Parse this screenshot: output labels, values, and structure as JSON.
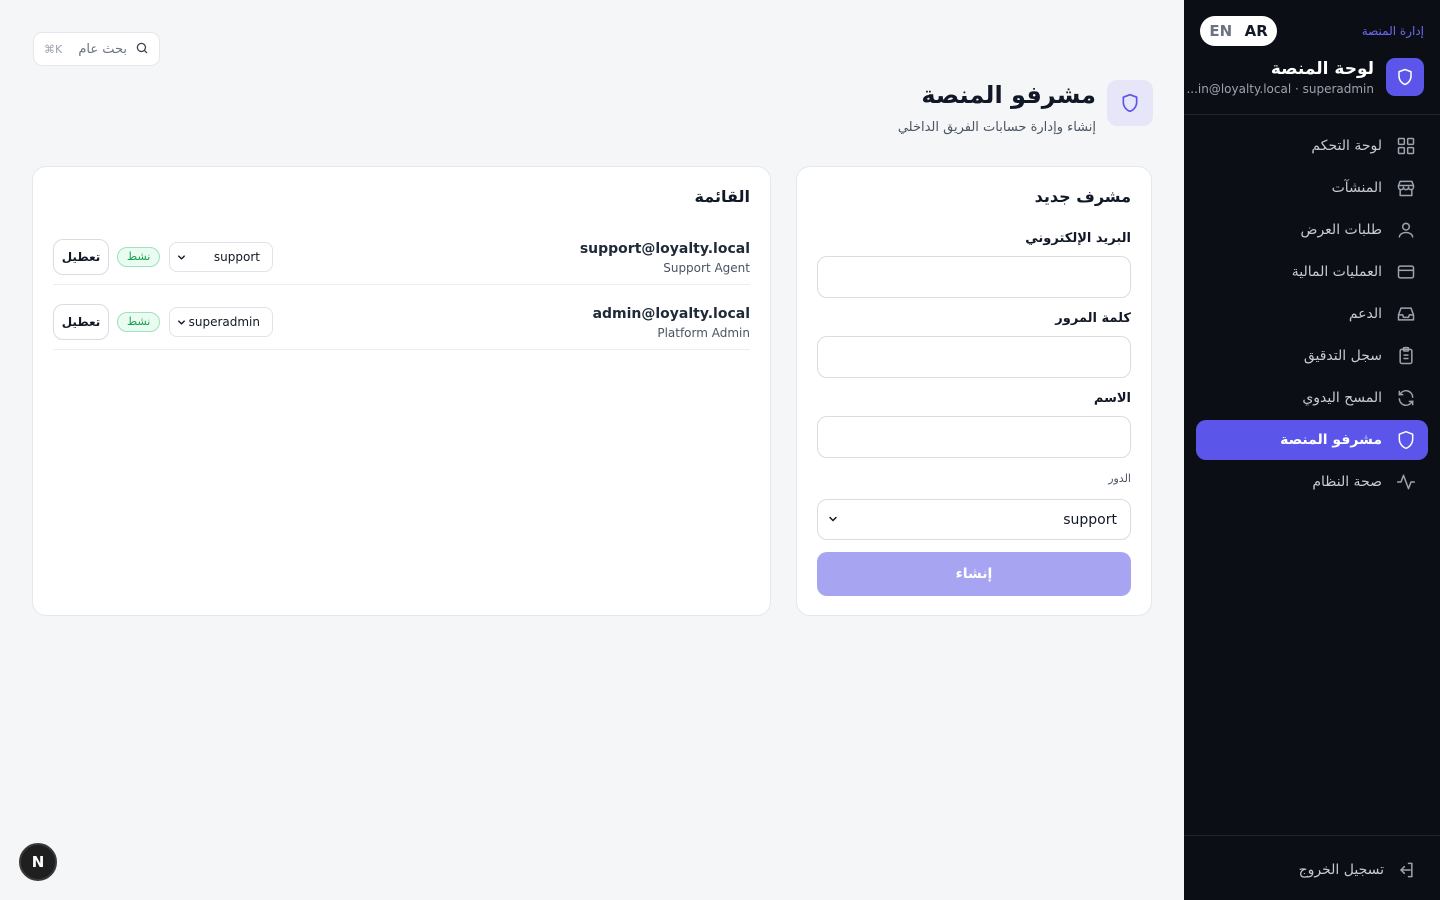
{
  "sidebar": {
    "section_label": "إدارة المنصة",
    "lang": {
      "en": "EN",
      "ar": "AR",
      "active": "AR"
    },
    "brand": {
      "title": "لوحة المنصة",
      "subtitle": "superadmin · admin@loyalty.local",
      "subtitle_display": "...in@loyalty.local · superadmin"
    },
    "nav": [
      {
        "label": "لوحة التحكم",
        "icon": "grid-icon"
      },
      {
        "label": "المنشآت",
        "icon": "store-icon"
      },
      {
        "label": "طلبات العرض",
        "icon": "user-icon"
      },
      {
        "label": "العمليات المالية",
        "icon": "card-icon"
      },
      {
        "label": "الدعم",
        "icon": "inbox-icon"
      },
      {
        "label": "سجل التدقيق",
        "icon": "clipboard-icon"
      },
      {
        "label": "المسح اليدوي",
        "icon": "refresh-icon"
      },
      {
        "label": "مشرفو المنصة",
        "icon": "shield-icon",
        "active": true
      },
      {
        "label": "صحة النظام",
        "icon": "activity-icon"
      }
    ],
    "logout_label": "تسجيل الخروج"
  },
  "search": {
    "placeholder": "بحث عام",
    "shortcut": "⌘K"
  },
  "page": {
    "title": "مشرفو المنصة",
    "subtitle": "إنشاء وإدارة حسابات الفريق الداخلي"
  },
  "form": {
    "title": "مشرف جديد",
    "email_label": "البريد الإلكتروني",
    "email_value": "",
    "password_label": "كلمة المرور",
    "password_value": "",
    "name_label": "الاسم",
    "name_value": "",
    "role_label": "الدور",
    "role_value": "support",
    "submit_label": "إنشاء"
  },
  "list": {
    "title": "القائمة",
    "rows": [
      {
        "email": "support@loyalty.local",
        "name": "Support Agent",
        "role": "support",
        "status": "نشط",
        "action": "تعطيل"
      },
      {
        "email": "admin@loyalty.local",
        "name": "Platform Admin",
        "role": "superadmin",
        "status": "نشط",
        "action": "تعطيل"
      }
    ]
  },
  "colors": {
    "accent": "#5b55ea",
    "sidebar_bg": "#0b0e14",
    "page_bg": "#f5f6f8",
    "success": "#16a34a",
    "button_disabled": "#a7a4f2"
  },
  "dev_badge": "N"
}
